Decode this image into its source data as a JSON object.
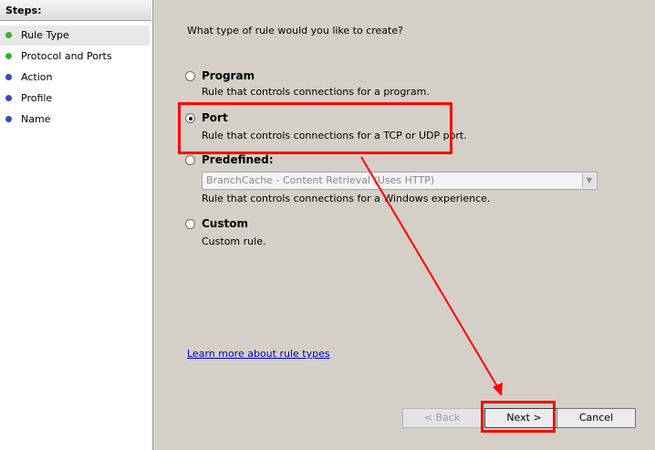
{
  "sidebar": {
    "header": "Steps:",
    "items": [
      {
        "label": "Rule Type",
        "icon": "green-dot-icon"
      },
      {
        "label": "Protocol and Ports",
        "icon": "green-dot-icon"
      },
      {
        "label": "Action",
        "icon": "blue-dot-icon"
      },
      {
        "label": "Profile",
        "icon": "blue-dot-icon"
      },
      {
        "label": "Name",
        "icon": "blue-dot-icon"
      }
    ]
  },
  "main": {
    "prompt": "What type of rule would you like to create?",
    "options": [
      {
        "title": "Program",
        "desc": "Rule that controls connections for a program.",
        "selected": false
      },
      {
        "title": "Port",
        "desc": "Rule that controls connections for a TCP or UDP port.",
        "selected": true
      },
      {
        "title": "Predefined:",
        "desc": "Rule that controls connections for a Windows experience.",
        "selected": false
      },
      {
        "title": "Custom",
        "desc": "Custom rule.",
        "selected": false
      }
    ],
    "predefined_value": "BranchCache - Content Retrieval (Uses HTTP)",
    "learn_more": "Learn more about rule types"
  },
  "buttons": {
    "back": "< Back",
    "next": "Next >",
    "cancel": "Cancel"
  },
  "colors": {
    "annotation": "#ff0000",
    "dot_green": "#3fae2a",
    "dot_blue": "#3b45c8"
  }
}
